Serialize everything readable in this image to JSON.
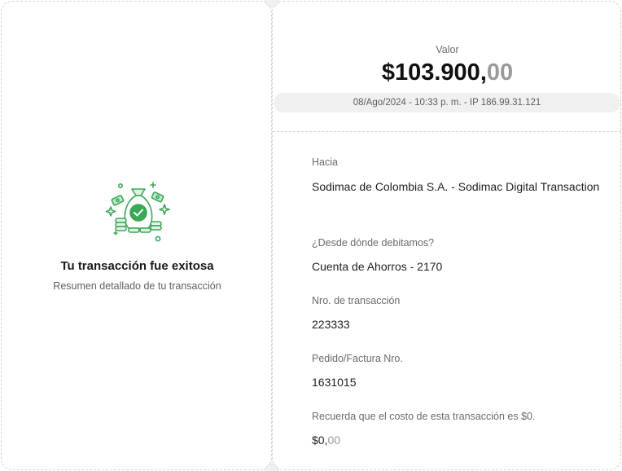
{
  "summary": {
    "title": "Tu transacción fue exitosa",
    "subtitle": "Resumen detallado de tu transacción",
    "illustration_icon": "money-bag-check-icon",
    "accent_color": "#3aa856"
  },
  "payment": {
    "amount_label": "Valor",
    "amount_main": "$103.900,",
    "amount_cents": "00",
    "meta": "08/Ago/2024 - 10:33 p. m. - IP 186.99.31.121"
  },
  "details": {
    "to_label": "Hacia",
    "to_value": "Sodimac de Colombia S.A. - Sodimac Digital Transaction",
    "from_label": "¿Desde dónde debitamos?",
    "from_value": "Cuenta de Ahorros - 2170",
    "transaction_label": "Nro. de transacción",
    "transaction_value": "223333",
    "order_label": "Pedido/Factura Nro.",
    "order_value": "1631015",
    "cost_label": "Recuerda que el costo de esta transacción es $0.",
    "cost_main": "$0,",
    "cost_cents": "00"
  }
}
